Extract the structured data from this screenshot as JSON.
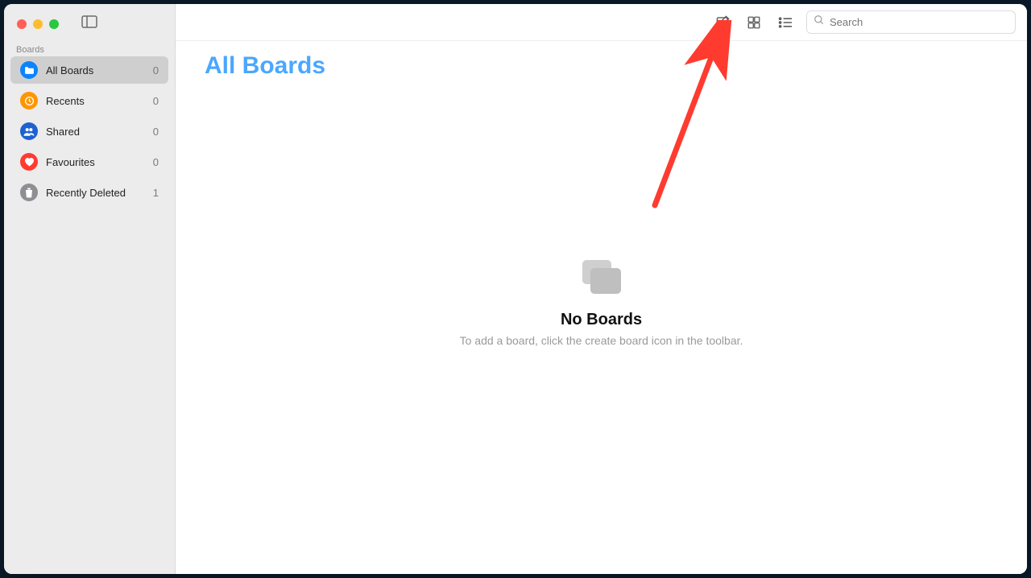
{
  "sidebar": {
    "section_label": "Boards",
    "items": [
      {
        "label": "All Boards",
        "count": "0",
        "icon": "folder",
        "color": "ic-blue",
        "active": true
      },
      {
        "label": "Recents",
        "count": "0",
        "icon": "clock",
        "color": "ic-orange",
        "active": false
      },
      {
        "label": "Shared",
        "count": "0",
        "icon": "people",
        "color": "ic-blue2",
        "active": false
      },
      {
        "label": "Favourites",
        "count": "0",
        "icon": "heart",
        "color": "ic-red",
        "active": false
      },
      {
        "label": "Recently Deleted",
        "count": "1",
        "icon": "trash",
        "color": "ic-gray",
        "active": false
      }
    ]
  },
  "toolbar": {
    "new_board_label": "New Board",
    "grid_view_label": "Grid View",
    "list_view_label": "List View"
  },
  "search": {
    "placeholder": "Search"
  },
  "main": {
    "title": "All Boards",
    "empty_title": "No Boards",
    "empty_subtitle": "To add a board, click the create board icon in the toolbar."
  },
  "colors": {
    "accent": "#4aa7ff",
    "annotation": "#ff3b30"
  }
}
